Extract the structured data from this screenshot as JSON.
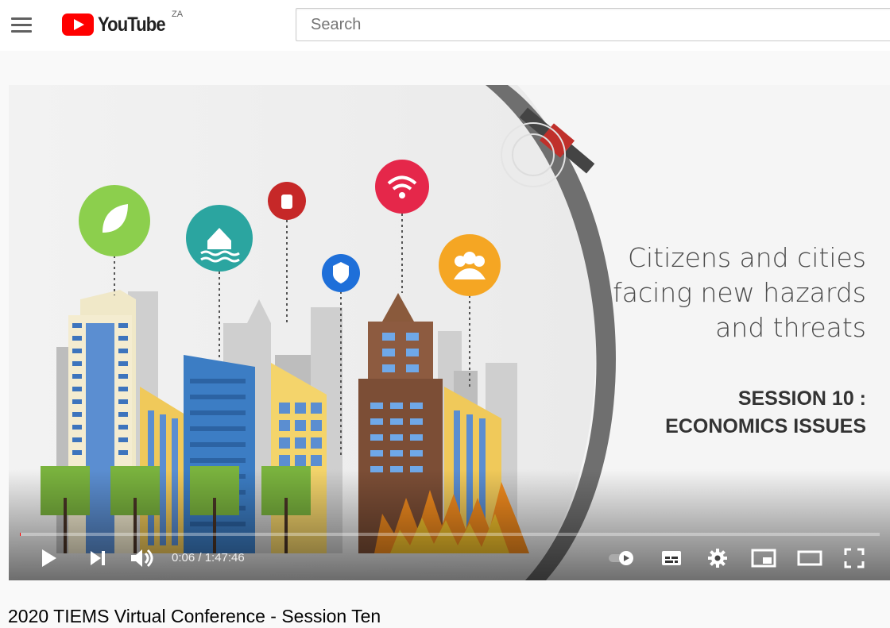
{
  "header": {
    "logo_text": "YouTube",
    "region": "ZA",
    "search_placeholder": "Search"
  },
  "video": {
    "overlay_title_lines": [
      "Citizens and cities",
      "facing new hazards",
      "and threats"
    ],
    "session_lines": [
      "SESSION 10 :",
      "ECONOMICS ISSUES"
    ],
    "time_display": "0:06 / 1:47:46",
    "progress": 0.001,
    "title": "2020 TIEMS Virtual Conference - Session Ten"
  },
  "colors": {
    "brand_red": "#ff0000",
    "icon_green": "#8ccf4d",
    "icon_teal": "#2ba5a0",
    "icon_red": "#c62828",
    "icon_blue": "#1e6fd9",
    "icon_pink": "#e5274a",
    "icon_orange": "#f5a623"
  },
  "icons": [
    "menu-icon",
    "youtube-logo",
    "leaf-icon",
    "house-flood-icon",
    "hydrant-icon",
    "shield-icon",
    "wifi-icon",
    "people-icon",
    "satellite-icon",
    "play-icon",
    "next-icon",
    "volume-icon",
    "autoplay-toggle",
    "subtitles-icon",
    "settings-icon",
    "miniplayer-icon",
    "theater-icon",
    "fullscreen-icon"
  ]
}
